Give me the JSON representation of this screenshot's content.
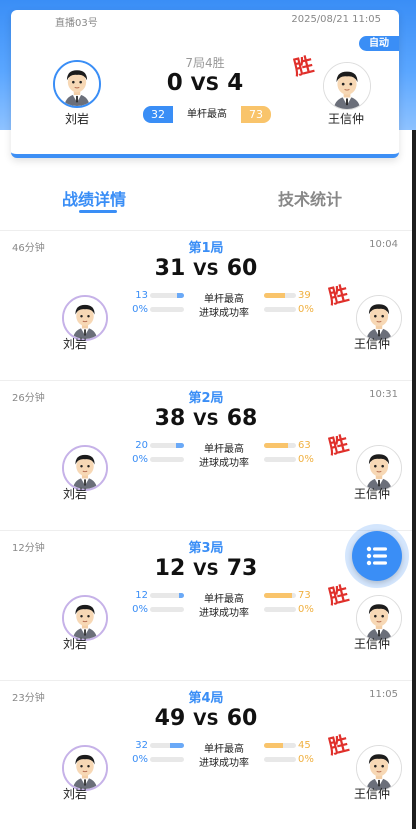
{
  "header": {
    "room": "直播03号",
    "datetime": "2025/08/21 11:05",
    "mode_badge": "自动",
    "format": "7局4胜",
    "score_left": "0",
    "vs": "VS",
    "score_right": "4",
    "highbreak_left": "32",
    "highbreak_label": "单杆最高",
    "highbreak_right": "73",
    "player_left": "刘岩",
    "player_right": "王信仲",
    "win_mark": "胜"
  },
  "tabs": [
    {
      "label": "战绩详情"
    },
    {
      "label": "技术统计"
    }
  ],
  "stat_labels": {
    "high_break": "单杆最高",
    "pot_rate": "进球成功率"
  },
  "rounds": [
    {
      "title": "第1局",
      "duration": "46分钟",
      "end_time": "10:04",
      "score_left": "31",
      "vs": "VS",
      "score_right": "60",
      "highbreak_left": "13",
      "highbreak_right": "39",
      "pot_left": "0%",
      "pot_right": "0%",
      "player_left": "刘岩",
      "player_right": "王信仲",
      "win_mark": "胜",
      "hb_left_frac": 0.2,
      "hb_right_frac": 0.65
    },
    {
      "title": "第2局",
      "duration": "26分钟",
      "end_time": "10:31",
      "score_left": "38",
      "vs": "VS",
      "score_right": "68",
      "highbreak_left": "20",
      "highbreak_right": "63",
      "pot_left": "0%",
      "pot_right": "0%",
      "player_left": "刘岩",
      "player_right": "王信仲",
      "win_mark": "胜",
      "hb_left_frac": 0.24,
      "hb_right_frac": 0.76
    },
    {
      "title": "第3局",
      "duration": "12分钟",
      "end_time": "",
      "score_left": "12",
      "vs": "VS",
      "score_right": "73",
      "highbreak_left": "12",
      "highbreak_right": "73",
      "pot_left": "0%",
      "pot_right": "0%",
      "player_left": "刘岩",
      "player_right": "王信仲",
      "win_mark": "胜",
      "hb_left_frac": 0.14,
      "hb_right_frac": 0.86
    },
    {
      "title": "第4局",
      "duration": "23分钟",
      "end_time": "11:05",
      "score_left": "49",
      "vs": "VS",
      "score_right": "60",
      "highbreak_left": "32",
      "highbreak_right": "45",
      "pot_left": "0%",
      "pot_right": "0%",
      "player_left": "刘岩",
      "player_right": "王信仲",
      "win_mark": "胜",
      "hb_left_frac": 0.42,
      "hb_right_frac": 0.58
    }
  ],
  "icons": {
    "avatar": "player-avatar-icon",
    "fab": "list-menu-icon"
  },
  "colors": {
    "accent": "#3a8ef6",
    "right_player": "#f9c46b",
    "win": "#e0302b"
  }
}
